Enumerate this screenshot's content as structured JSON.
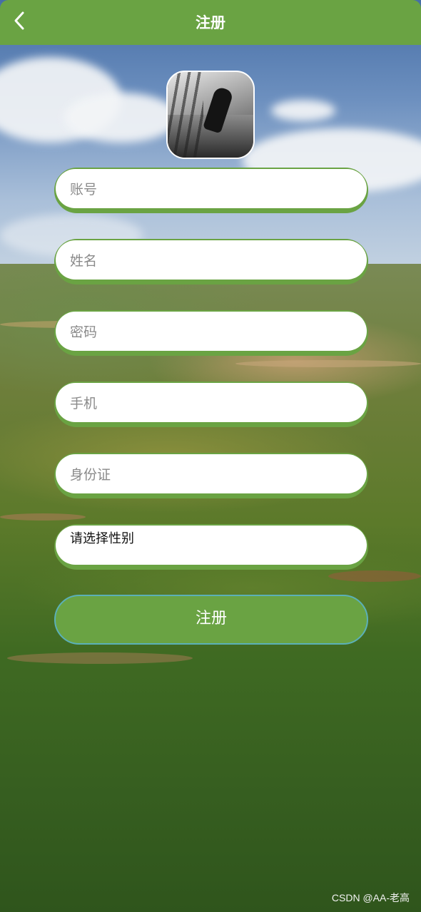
{
  "header": {
    "title": "注册",
    "back_icon": "chevron-left-icon"
  },
  "avatar": {
    "description_icon": "avatar-image"
  },
  "form": {
    "fields": [
      {
        "placeholder": "账号",
        "value": ""
      },
      {
        "placeholder": "姓名",
        "value": ""
      },
      {
        "placeholder": "密码",
        "value": ""
      },
      {
        "placeholder": "手机",
        "value": ""
      },
      {
        "placeholder": "身份证",
        "value": ""
      }
    ],
    "gender_select": {
      "selected": "请选择性别"
    },
    "submit_label": "注册"
  },
  "watermark": "CSDN @AA-老高",
  "colors": {
    "accent": "#6aa343",
    "submit_border": "#5bb0b8",
    "text_placeholder": "#8a8a8a"
  }
}
